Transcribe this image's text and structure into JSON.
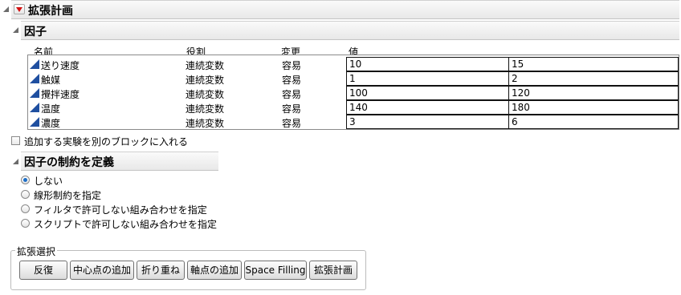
{
  "title": "拡張計画",
  "factors_section": {
    "title": "因子",
    "columns": {
      "name": "名前",
      "role": "役割",
      "changes": "変更",
      "values": "値"
    },
    "rows": [
      {
        "name": "送り速度",
        "role": "連続変数",
        "changes": "容易",
        "low": "10",
        "high": "15"
      },
      {
        "name": "触媒",
        "role": "連続変数",
        "changes": "容易",
        "low": "1",
        "high": "2"
      },
      {
        "name": "攪拌速度",
        "role": "連続変数",
        "changes": "容易",
        "low": "100",
        "high": "120"
      },
      {
        "name": "温度",
        "role": "連続変数",
        "changes": "容易",
        "low": "140",
        "high": "180"
      },
      {
        "name": "濃度",
        "role": "連続変数",
        "changes": "容易",
        "low": "3",
        "high": "6"
      }
    ]
  },
  "block_checkbox": {
    "label": "追加する実験を別のブロックに入れる",
    "checked": false
  },
  "constraints_section": {
    "title": "因子の制約を定義",
    "options": [
      {
        "label": "しない",
        "selected": true
      },
      {
        "label": "線形制約を指定",
        "selected": false
      },
      {
        "label": "フィルタで許可しない組み合わせを指定",
        "selected": false
      },
      {
        "label": "スクリプトで許可しない組み合わせを指定",
        "selected": false
      }
    ]
  },
  "augment_choices": {
    "legend": "拡張選択",
    "buttons": [
      "反復",
      "中心点の追加",
      "折り重ね",
      "軸点の追加",
      "Space Filling",
      "拡張計画"
    ]
  },
  "colors": {
    "selected_radio": "#1e6fc8",
    "menu_arrow": "#d31010",
    "factor_icon": "#1f4fa0"
  }
}
